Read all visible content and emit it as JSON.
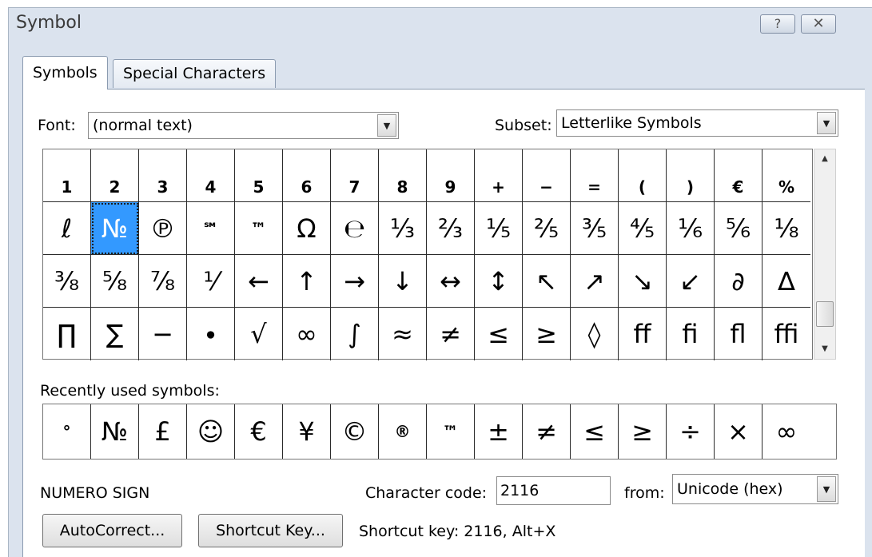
{
  "window": {
    "title": "Symbol",
    "help_label": "?",
    "close_label": "✕"
  },
  "tabs": [
    {
      "label": "Symbols",
      "active": true
    },
    {
      "label": "Special Characters",
      "active": false
    }
  ],
  "font": {
    "label": "Font:",
    "value": "(normal text)"
  },
  "subset": {
    "label": "Subset:",
    "value": "Letterlike Symbols"
  },
  "symbol_grid": {
    "rows": [
      [
        "1",
        "2",
        "3",
        "4",
        "5",
        "6",
        "7",
        "8",
        "9",
        "+",
        "−",
        "=",
        "(",
        ")",
        "€",
        "%"
      ],
      [
        "ℓ",
        "№",
        "℗",
        "℠",
        "™",
        "Ω",
        "℮",
        "⅓",
        "⅔",
        "⅕",
        "⅖",
        "⅗",
        "⅘",
        "⅙",
        "⅚",
        "⅛"
      ],
      [
        "⅜",
        "⅝",
        "⅞",
        "⅟",
        "←",
        "↑",
        "→",
        "↓",
        "↔",
        "↕",
        "↖",
        "↗",
        "↘",
        "↙",
        "∂",
        "∆"
      ],
      [
        "∏",
        "∑",
        "−",
        "∙",
        "√",
        "∞",
        "∫",
        "≈",
        "≠",
        "≤",
        "≥",
        "◊",
        "ff",
        "fi",
        "fl",
        "ffi"
      ]
    ],
    "selected": "№"
  },
  "recent": {
    "label": "Recently used symbols:",
    "symbols": [
      "°",
      "№",
      "£",
      "☺",
      "€",
      "¥",
      "©",
      "®",
      "™",
      "±",
      "≠",
      "≤",
      "≥",
      "÷",
      "×",
      "∞"
    ]
  },
  "character_name": "NUMERO SIGN",
  "character_code": {
    "label": "Character code:",
    "value": "2116"
  },
  "from": {
    "label": "from:",
    "value": "Unicode (hex)"
  },
  "buttons": {
    "autocorrect": "AutoCorrect...",
    "shortcut_key": "Shortcut Key..."
  },
  "shortcut_text": "Shortcut key: 2116, Alt+X",
  "icons": {
    "dropdown": "chevron-down-icon",
    "scroll_up": "scroll-up-icon",
    "scroll_down": "scroll-down-icon"
  }
}
